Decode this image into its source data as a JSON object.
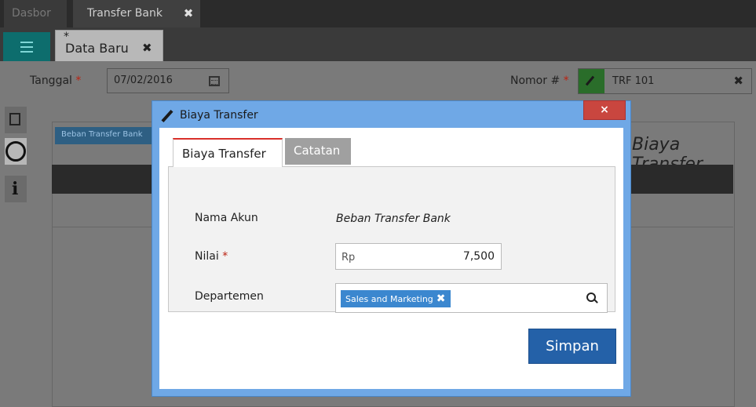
{
  "top_tabs": [
    {
      "label": "Dasbor"
    },
    {
      "label": "Transfer Bank"
    }
  ],
  "doc_tab": {
    "dirty_marker": "*",
    "label": "Data Baru"
  },
  "form": {
    "tanggal_label": "Tanggal",
    "tanggal_value": "07/02/2016",
    "nomor_label": "Nomor #",
    "nomor_value": "TRF 101",
    "required_mark": "*"
  },
  "background": {
    "chip_label": "Beban Transfer Bank",
    "section_title": "Biaya Transfer"
  },
  "modal": {
    "title": "Biaya Transfer",
    "close_label": "×",
    "tabs": [
      {
        "label": "Biaya Transfer",
        "active": true
      },
      {
        "label": "Catatan",
        "active": false
      }
    ],
    "fields": {
      "nama_akun_label": "Nama Akun",
      "nama_akun_value": "Beban Transfer Bank",
      "nilai_label": "Nilai",
      "nilai_prefix": "Rp",
      "nilai_value": "7,500",
      "departemen_label": "Departemen",
      "departemen_chip": "Sales and Marketing"
    },
    "save_label": "Simpan"
  },
  "icons": {
    "menu": "list-icon",
    "calendar": "calendar-icon",
    "edit": "pencil-icon",
    "sidebar": [
      "document-icon",
      "coins-icon",
      "info-icon"
    ],
    "search": "search-icon"
  },
  "colors": {
    "modal_header": "#6fa8e6",
    "close_button": "#c9463f",
    "save_button": "#2461a8",
    "chip": "#3b87cf",
    "active_tab_accent": "#d9302a"
  }
}
